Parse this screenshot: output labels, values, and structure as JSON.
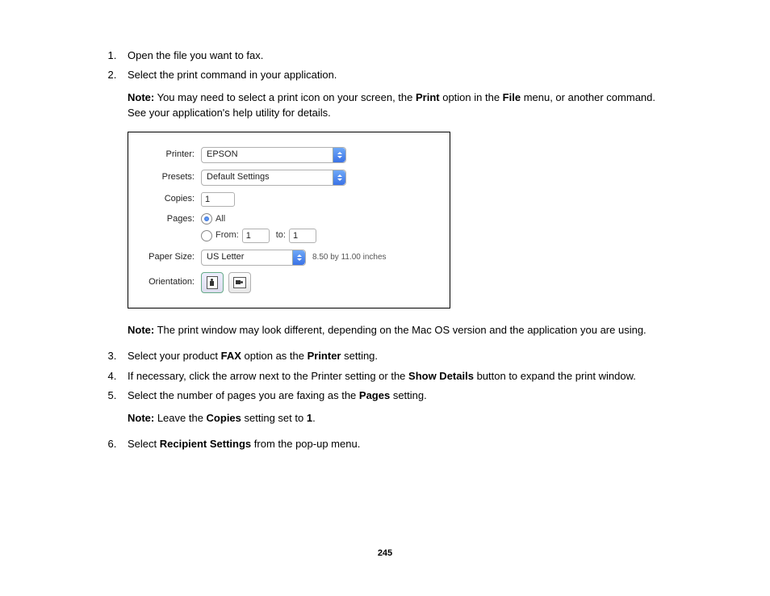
{
  "steps": {
    "s1": "Open the file you want to fax.",
    "s2": "Select the print command in your application.",
    "s2_note_prefix": "Note:",
    "s2_note_a": " You may need to select a print icon on your screen, the ",
    "s2_note_b": "Print",
    "s2_note_c": " option in the ",
    "s2_note_d": "File",
    "s2_note_e": " menu, or another command. See your application's help utility for details.",
    "s2_note2_prefix": "Note:",
    "s2_note2_body": " The print window may look different, depending on the Mac OS version and the application you are using.",
    "s3_a": "Select your product ",
    "s3_b": "FAX",
    "s3_c": " option as the ",
    "s3_d": "Printer",
    "s3_e": " setting.",
    "s4_a": "If necessary, click the arrow next to the Printer setting or the ",
    "s4_b": "Show Details",
    "s4_c": " button to expand the print window.",
    "s5_a": "Select the number of pages you are faxing as the ",
    "s5_b": "Pages",
    "s5_c": " setting.",
    "s5_note_prefix": "Note:",
    "s5_note_a": " Leave the ",
    "s5_note_b": "Copies",
    "s5_note_c": " setting set to ",
    "s5_note_d": "1",
    "s5_note_e": ".",
    "s6_a": "Select ",
    "s6_b": "Recipient Settings",
    "s6_c": " from the pop-up menu."
  },
  "dialog": {
    "labels": {
      "printer": "Printer:",
      "presets": "Presets:",
      "copies": "Copies:",
      "pages": "Pages:",
      "from": "From:",
      "to": "to:",
      "paper_size": "Paper Size:",
      "orientation": "Orientation:"
    },
    "values": {
      "printer": "EPSON",
      "presets": "Default Settings",
      "copies": "1",
      "pages_all": "All",
      "from": "1",
      "to": "1",
      "paper_size": "US Letter",
      "paper_dim": "8.50 by 11.00 inches"
    }
  },
  "page_number": "245"
}
